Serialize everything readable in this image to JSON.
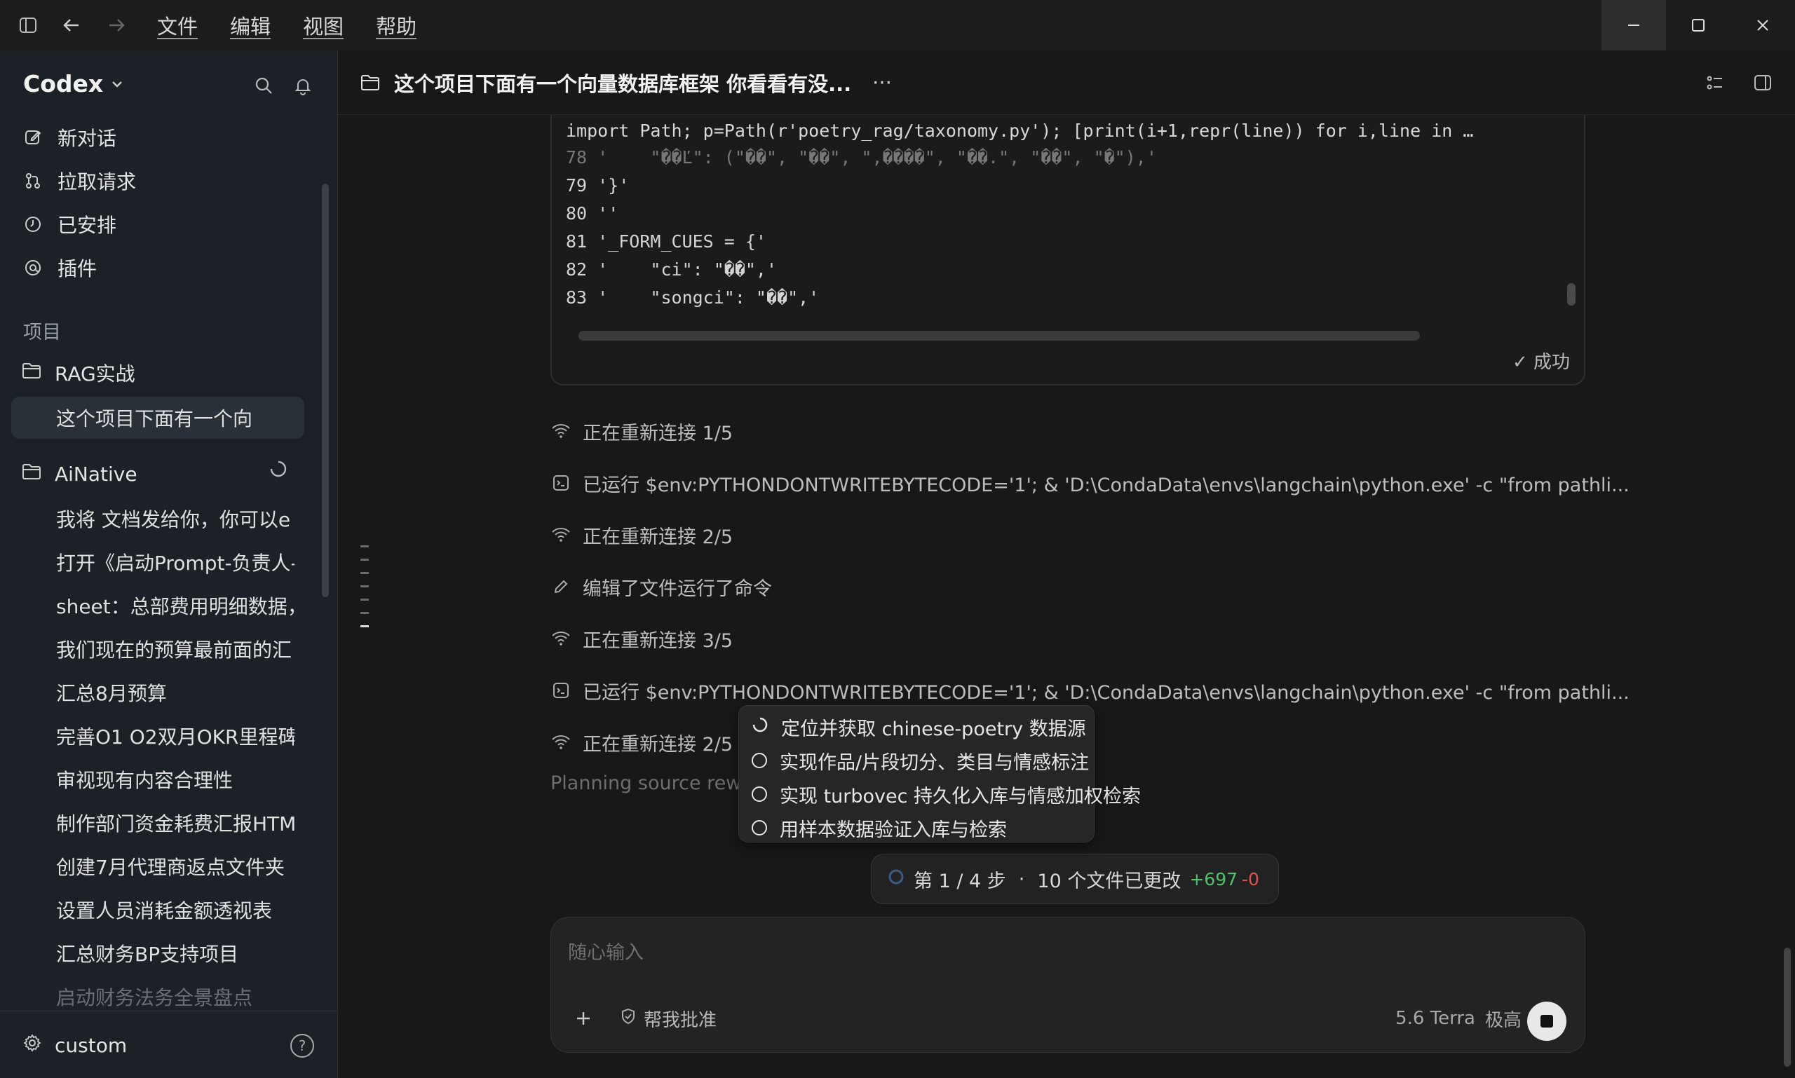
{
  "menu": {
    "file": "文件",
    "edit": "编辑",
    "view": "视图",
    "help": "帮助"
  },
  "sidebar": {
    "brand": "Codex",
    "nav": [
      {
        "label": "新对话",
        "icon": "edit-icon"
      },
      {
        "label": "拉取请求",
        "icon": "pull-request-icon"
      },
      {
        "label": "已安排",
        "icon": "clock-icon"
      },
      {
        "label": "插件",
        "icon": "plugin-icon"
      }
    ],
    "projects_label": "项目",
    "project1": {
      "name": "RAG实战",
      "active_thread": "这个项目下面有一个向"
    },
    "project2": {
      "name": "AiNative",
      "threads": [
        "我将 文档发给你，你可以e",
        "打开《启动Prompt-负责人-",
        "sheet：总部费用明细数据，",
        "我们现在的预算最前面的汇",
        "汇总8月预算",
        "完善O1 O2双月OKR里程碑",
        "审视现有内容合理性",
        "制作部门资金耗费汇报HTM",
        "创建7月代理商返点文件夹",
        "设置人员消耗金额透视表",
        "汇总财务BP支持项目",
        "启动财务法务全景盘点"
      ]
    },
    "footer_user": "custom"
  },
  "header": {
    "title": "这个项目下面有一个向量数据库框架 你看看有没...",
    "more": "···"
  },
  "code": {
    "command": "import Path; p=Path(r'poetry_rag/taxonomy.py'); [print(i+1,repr(line)) for i,line in …",
    "lines": [
      "78 '    \"��Ľ\": (\"��\", \"��\", \",����\", \"��.\", \"��\", \"�\"),'",
      "79 '}'",
      "80 ''",
      "81 '_FORM_CUES = {'",
      "82 '    \"ci\": \"��\",'",
      "83 '    \"songci\": \"��\",'"
    ],
    "status": "✓ 成功"
  },
  "activity": [
    {
      "icon": "wifi-icon",
      "text": "正在重新连接 1/5"
    },
    {
      "icon": "terminal-icon",
      "text": "已运行 $env:PYTHONDONTWRITEBYTECODE='1'; & 'D:\\CondaData\\envs\\langchain\\python.exe' -c \"from pathli..."
    },
    {
      "icon": "wifi-icon",
      "text": "正在重新连接 2/5"
    },
    {
      "icon": "pencil-icon",
      "text": "编辑了文件运行了命令"
    },
    {
      "icon": "wifi-icon",
      "text": "正在重新连接 3/5"
    },
    {
      "icon": "terminal-icon",
      "text": "已运行 $env:PYTHONDONTWRITEBYTECODE='1'; & 'D:\\CondaData\\envs\\langchain\\python.exe' -c \"from pathli..."
    },
    {
      "icon": "wifi-icon",
      "text": "正在重新连接 2/5"
    }
  ],
  "planning": "Planning source rewri",
  "plan": [
    {
      "text": "定位并获取 chinese-poetry 数据源",
      "state": "in-progress"
    },
    {
      "text": "实现作品/片段切分、类目与情感标注",
      "state": "pending"
    },
    {
      "text": "实现 turbovec 持久化入库与情感加权检索",
      "state": "pending"
    },
    {
      "text": "用样本数据验证入库与检索",
      "state": "pending"
    }
  ],
  "status": {
    "step": "第 1 / 4 步",
    "sep": "·",
    "files": "10 个文件已更改",
    "added": "+697",
    "removed": "-0"
  },
  "composer": {
    "placeholder": "随心输入",
    "approve": "帮我批准",
    "model": "5.6 Terra",
    "effort": "极高"
  },
  "colors": {
    "added": "#4ec26c",
    "removed": "#e0524a",
    "sidebar_bg": "#1c2128",
    "main_bg": "#181818"
  }
}
